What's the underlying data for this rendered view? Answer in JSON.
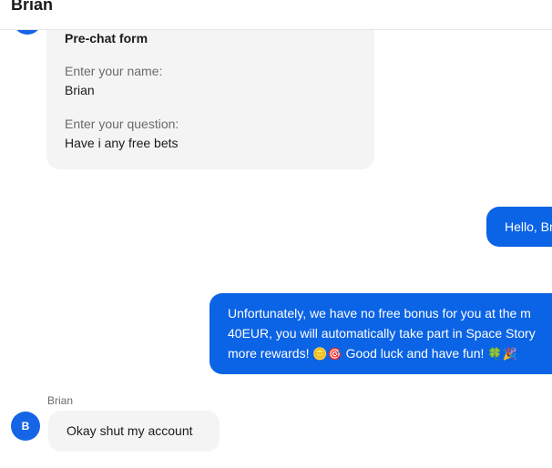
{
  "header": {
    "title": "Brian"
  },
  "avatar": {
    "initial": "B"
  },
  "prechat": {
    "title": "Pre-chat form",
    "name_label": "Enter your name:",
    "name_value": "Brian",
    "question_label": "Enter your question:",
    "question_value": "Have i any free bets"
  },
  "messages": {
    "agent_greeting": "Hello, Bri",
    "agent_reply": {
      "line1": "Unfortunately, we have no free bonus for you at the m",
      "line2": "40EUR, you will automatically take part in Space Story",
      "line3_text": "more rewards! ",
      "line3_emoji1": "🪙🎯",
      "line3_mid": " Good luck and have fun! ",
      "line3_emoji2": "🍀🎉"
    },
    "user_name": "Brian",
    "user_message": "Okay shut my account"
  },
  "colors": {
    "accent": "#0b63e5",
    "bubble_in": "#f4f4f4"
  }
}
